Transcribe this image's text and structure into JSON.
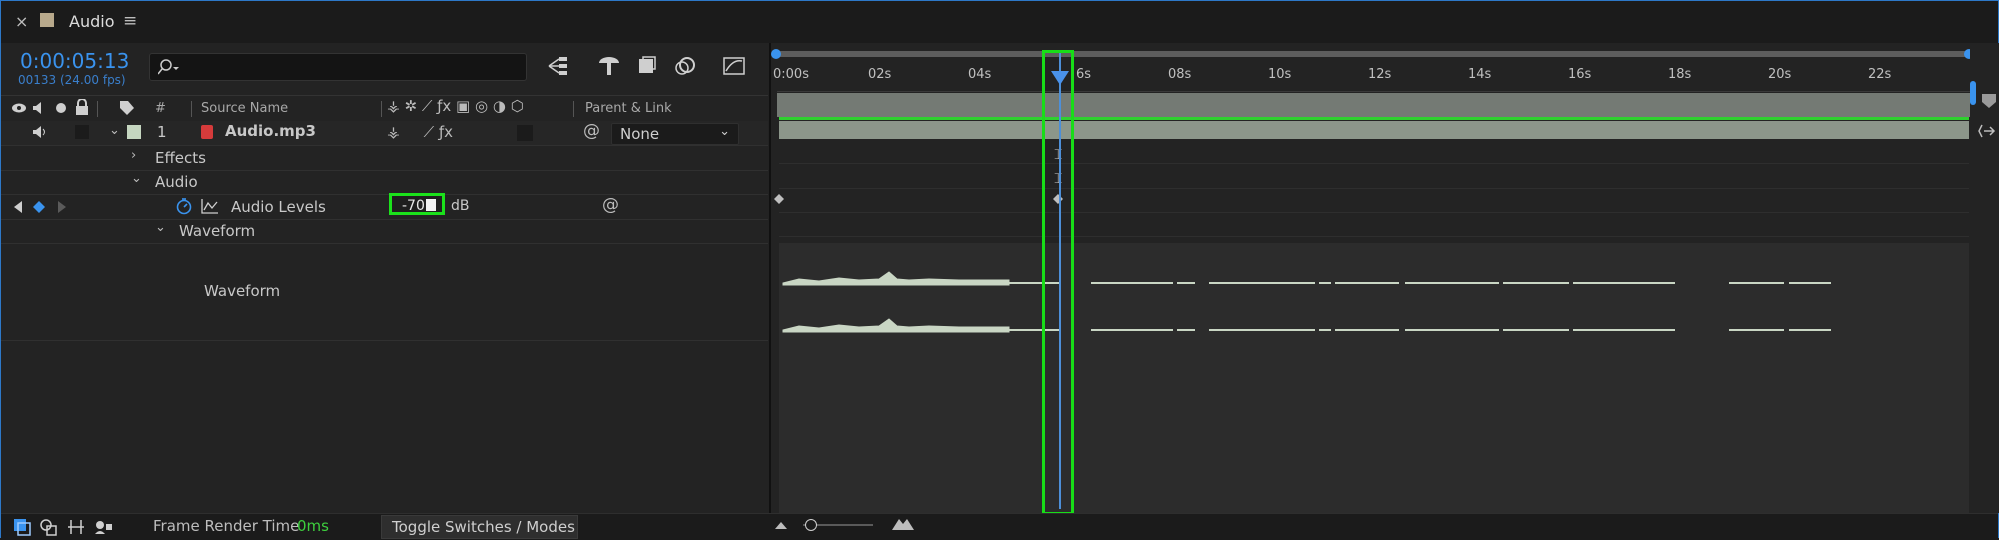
{
  "tab": {
    "close": "×",
    "title": "Audio",
    "menu": "≡"
  },
  "header": {
    "timecode": "0:00:05:13",
    "frames": "00133 (24.00 fps)"
  },
  "columns": {
    "hash": "#",
    "source_name": "Source Name",
    "parent_link": "Parent & Link"
  },
  "layer": {
    "number": "1",
    "name": "Audio.mp3",
    "parent": "None"
  },
  "properties": {
    "effects": "Effects",
    "audio": "Audio",
    "audio_levels": "Audio Levels",
    "audio_levels_value": "-70",
    "audio_levels_unit": "dB",
    "waveform_group": "Waveform",
    "waveform": "Waveform"
  },
  "timeline": {
    "ticks": [
      "0:00s",
      "02s",
      "04s",
      "6s",
      "08s",
      "10s",
      "12s",
      "14s",
      "16s",
      "18s",
      "20s",
      "22s"
    ],
    "playhead_seconds": 5.54
  },
  "footer": {
    "frame_render_label": "Frame Render Time",
    "frame_render_value": "0ms",
    "toggle": "Toggle Switches / Modes"
  },
  "colors": {
    "accent": "#3a93ee",
    "highlight": "#18dd18",
    "render_time": "#3ecf3e"
  },
  "icons": [
    "close-icon",
    "menu-icon",
    "search-icon",
    "eye-icon",
    "speaker-icon",
    "solo-icon",
    "lock-icon",
    "label-icon",
    "stopwatch-icon",
    "graph-icon",
    "keyframe-icon",
    "pickwhip-icon",
    "comp-flowchart-icon"
  ]
}
